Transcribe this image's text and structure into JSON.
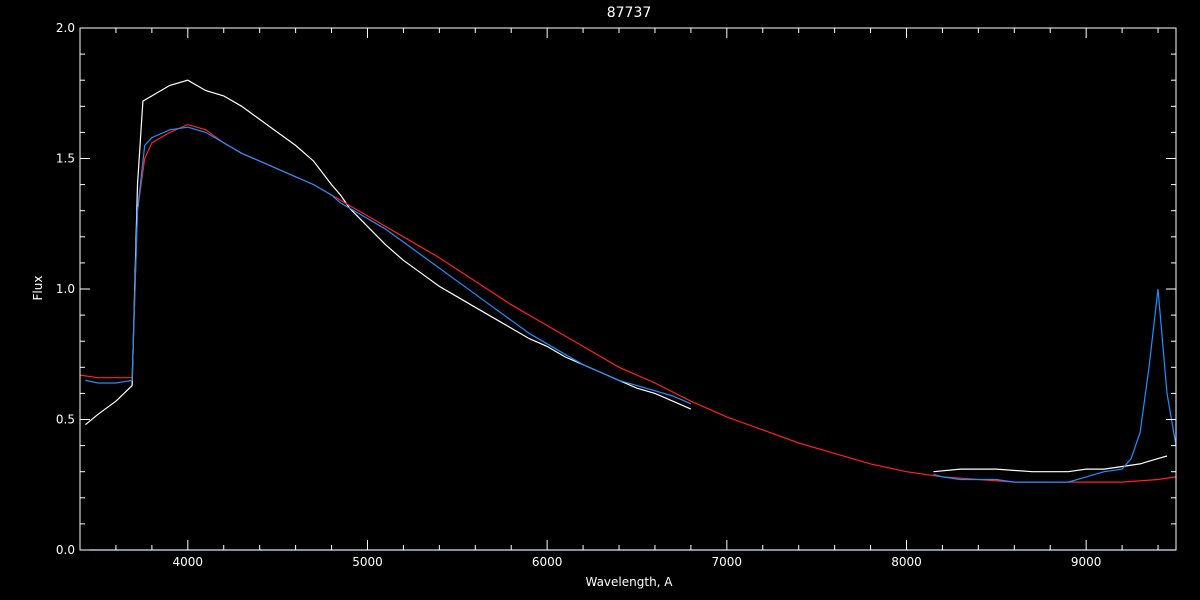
{
  "chart_data": {
    "type": "line",
    "title": "87737",
    "xlabel": "Wavelength, A",
    "ylabel": "Flux",
    "xlim": [
      3400,
      9500
    ],
    "ylim": [
      0,
      2.0
    ],
    "x_ticks": [
      4000,
      5000,
      6000,
      7000,
      8000,
      9000
    ],
    "y_ticks": [
      "0.0",
      "0.5",
      "1.0",
      "1.5",
      "2.0"
    ],
    "grid": false,
    "colors": {
      "background": "#000000",
      "axes": "#ffffff",
      "model": "#ff2020",
      "observed_white": "#ffffff",
      "observed_blue": "#1e90ff"
    },
    "series": [
      {
        "color": "#ffffff",
        "x": [
          3430,
          3500,
          3600,
          3690,
          3720,
          3750,
          3800,
          3900,
          4000,
          4100,
          4200,
          4300,
          4400,
          4500,
          4600,
          4700,
          4800,
          4850,
          4900,
          5000,
          5100,
          5200,
          5300,
          5400,
          5500,
          5600,
          5700,
          5800,
          5900,
          6000,
          6100,
          6200,
          6300,
          6400,
          6500,
          6600,
          6700,
          6800
        ],
        "y": [
          0.48,
          0.52,
          0.57,
          0.63,
          1.4,
          1.72,
          1.74,
          1.78,
          1.8,
          1.76,
          1.74,
          1.7,
          1.65,
          1.6,
          1.55,
          1.49,
          1.4,
          1.36,
          1.31,
          1.24,
          1.17,
          1.11,
          1.06,
          1.01,
          0.97,
          0.93,
          0.89,
          0.85,
          0.81,
          0.78,
          0.74,
          0.71,
          0.68,
          0.65,
          0.62,
          0.6,
          0.57,
          0.54
        ]
      },
      {
        "color": "#ffffff",
        "x": [
          8150,
          8300,
          8500,
          8700,
          8900,
          9000,
          9100,
          9200,
          9300,
          9400,
          9450
        ],
        "y": [
          0.3,
          0.31,
          0.31,
          0.3,
          0.3,
          0.31,
          0.31,
          0.32,
          0.33,
          0.35,
          0.36
        ]
      },
      {
        "color": "#ff2020",
        "x": [
          3400,
          3500,
          3600,
          3690,
          3720,
          3760,
          3800,
          3900,
          4000,
          4100,
          4200,
          4300,
          4400,
          4500,
          4600,
          4700,
          4800,
          4900,
          5000,
          5200,
          5400,
          5600,
          5800,
          6000,
          6200,
          6400,
          6600,
          6800,
          7000,
          7200,
          7400,
          7600,
          7800,
          8000,
          8200,
          8400,
          8600,
          8800,
          9000,
          9200,
          9400,
          9500
        ],
        "y": [
          0.67,
          0.66,
          0.66,
          0.66,
          1.3,
          1.5,
          1.56,
          1.6,
          1.63,
          1.61,
          1.56,
          1.52,
          1.49,
          1.46,
          1.43,
          1.4,
          1.36,
          1.32,
          1.28,
          1.2,
          1.12,
          1.03,
          0.94,
          0.86,
          0.78,
          0.7,
          0.64,
          0.57,
          0.51,
          0.46,
          0.41,
          0.37,
          0.33,
          0.3,
          0.28,
          0.27,
          0.26,
          0.26,
          0.26,
          0.26,
          0.27,
          0.28
        ]
      },
      {
        "color": "#1e90ff",
        "x": [
          3430,
          3500,
          3600,
          3690,
          3720,
          3760,
          3800,
          3900,
          4000,
          4100,
          4200,
          4300,
          4400,
          4500,
          4600,
          4700,
          4800,
          4850,
          4900,
          5000,
          5100,
          5200,
          5300,
          5400,
          5500,
          5600,
          5700,
          5800,
          5900,
          6000,
          6100,
          6200,
          6300,
          6400,
          6500,
          6600,
          6700,
          6800
        ],
        "y": [
          0.65,
          0.64,
          0.64,
          0.65,
          1.3,
          1.55,
          1.58,
          1.61,
          1.62,
          1.6,
          1.56,
          1.52,
          1.49,
          1.46,
          1.43,
          1.4,
          1.36,
          1.33,
          1.31,
          1.27,
          1.23,
          1.18,
          1.13,
          1.08,
          1.03,
          0.98,
          0.93,
          0.88,
          0.83,
          0.79,
          0.75,
          0.71,
          0.68,
          0.65,
          0.63,
          0.61,
          0.59,
          0.56
        ]
      },
      {
        "color": "#1e90ff",
        "x": [
          8150,
          8200,
          8300,
          8400,
          8500,
          8600,
          8700,
          8800,
          8900,
          9000,
          9100,
          9200,
          9250,
          9300,
          9350,
          9400,
          9450,
          9500
        ],
        "y": [
          0.29,
          0.28,
          0.27,
          0.27,
          0.27,
          0.26,
          0.26,
          0.26,
          0.26,
          0.28,
          0.3,
          0.31,
          0.35,
          0.45,
          0.7,
          1.0,
          0.6,
          0.4
        ]
      },
      {
        "color": "#1e90ff",
        "x": [
          3450,
          9500
        ],
        "y": [
          0.0,
          0.0
        ]
      }
    ]
  }
}
